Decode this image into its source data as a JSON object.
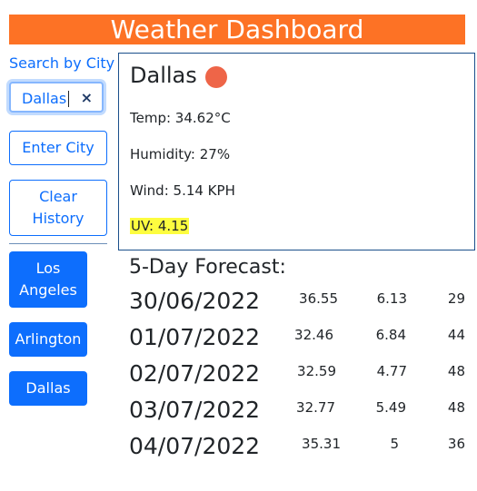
{
  "header": {
    "title": "Weather Dashboard",
    "color": "#fd7225"
  },
  "sidebar": {
    "search_label": "Search by City",
    "search_value": "Dallas",
    "clear_glyph": "×",
    "enter_button": "Enter City",
    "clear_history_line1": "Clear",
    "clear_history_line2": "History",
    "history": [
      {
        "line1": "Los",
        "line2": "Angeles"
      },
      {
        "label": "Arlington"
      },
      {
        "label": "Dallas"
      }
    ],
    "accent": "#0d6efd"
  },
  "current": {
    "city": "Dallas",
    "icon": "weather-icon",
    "temp": "Temp: 34.62°C",
    "humidity": "Humidity: 27%",
    "wind": "Wind: 5.14 KPH",
    "uv": "UV: 4.15",
    "uv_highlight": "#fdfd3f"
  },
  "forecast": {
    "title": "5-Day Forecast:",
    "days": [
      {
        "date": "30/06/2022",
        "temp": "36.55",
        "wind": "6.13",
        "humidity": "29"
      },
      {
        "date": "01/07/2022",
        "temp": "32.46",
        "wind": "6.84",
        "humidity": "44"
      },
      {
        "date": "02/07/2022",
        "temp": "32.59",
        "wind": "4.77",
        "humidity": "48"
      },
      {
        "date": "03/07/2022",
        "temp": "32.77",
        "wind": "5.49",
        "humidity": "48"
      },
      {
        "date": "04/07/2022",
        "temp": "35.31",
        "wind": "5",
        "humidity": "36"
      }
    ]
  }
}
